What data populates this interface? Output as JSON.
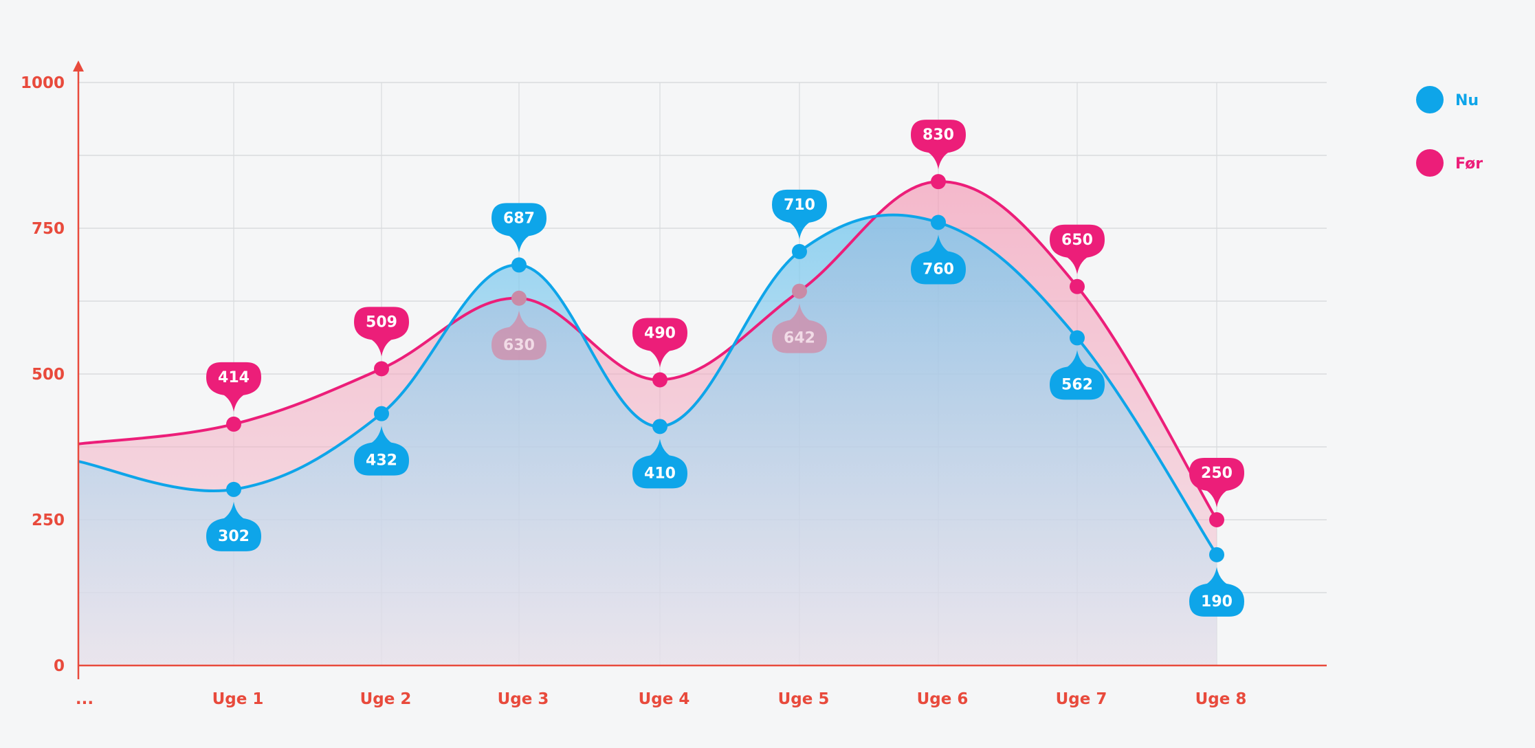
{
  "chart_data": {
    "type": "area",
    "categories": [
      "...",
      "Uge 1",
      "Uge 2",
      "Uge 3",
      "Uge 4",
      "Uge 5",
      "Uge 6",
      "Uge 7",
      "Uge 8"
    ],
    "y_ticks": [
      "0",
      "250",
      "500",
      "750",
      "1000"
    ],
    "ylim": [
      0,
      1000
    ],
    "grid": true,
    "legend_position": "top-right",
    "series": [
      {
        "name": "Nu",
        "color": "#0ea5e9",
        "start_value": 350,
        "values": [
          302,
          432,
          687,
          410,
          710,
          760,
          562,
          190
        ],
        "labels": [
          "302",
          "432",
          "687",
          "410",
          "710",
          "760",
          "562",
          "190"
        ],
        "label_side": [
          "below",
          "below",
          "above",
          "below",
          "above",
          "below",
          "below",
          "below"
        ]
      },
      {
        "name": "Før",
        "color": "#ec1e79",
        "start_value": 380,
        "values": [
          414,
          509,
          630,
          490,
          642,
          830,
          650,
          250
        ],
        "labels": [
          "414",
          "509",
          "630",
          "490",
          "642",
          "830",
          "650",
          "250"
        ],
        "label_side": [
          "above",
          "above",
          "below",
          "above",
          "below",
          "above",
          "above",
          "above"
        ]
      }
    ]
  },
  "colors": {
    "axis": "#e84a3c",
    "grid": "#d9dbde",
    "background": "#f5f6f7"
  }
}
